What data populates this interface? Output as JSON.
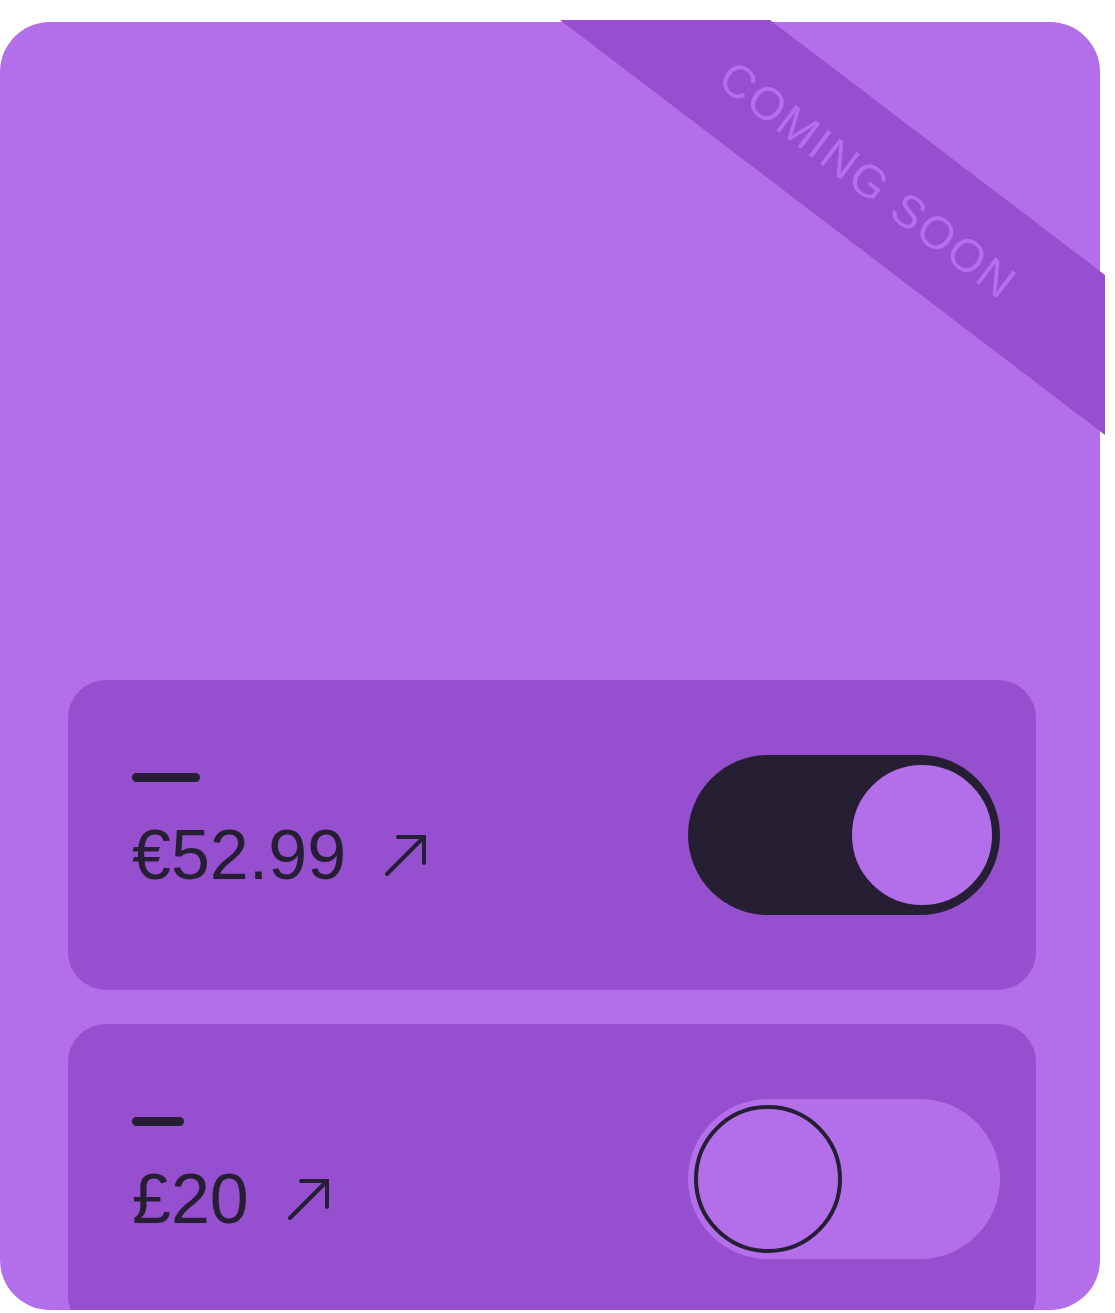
{
  "ribbon": {
    "label": "COMING SOON"
  },
  "plans": [
    {
      "price": "€52.99",
      "on": true
    },
    {
      "price": "£20",
      "on": false
    }
  ]
}
